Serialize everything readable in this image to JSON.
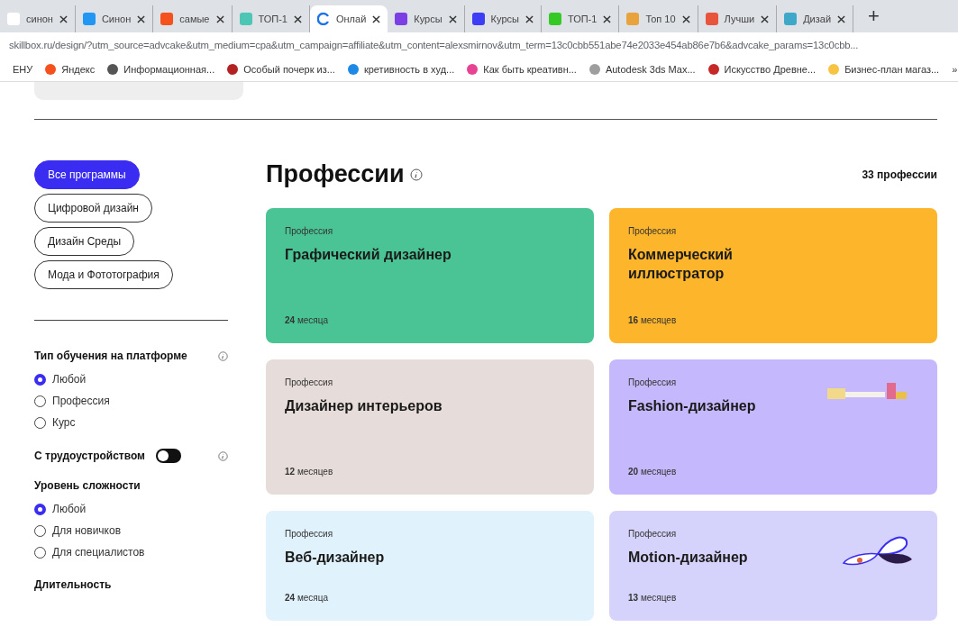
{
  "browser": {
    "tabs": [
      {
        "title": "синон",
        "selected": false,
        "color": "#ffffff"
      },
      {
        "title": "Синон",
        "selected": false,
        "color": "#2196f3"
      },
      {
        "title": "самые",
        "selected": false,
        "color": "#f4511e"
      },
      {
        "title": "ТОП-1",
        "selected": false,
        "color": "#4dc6b5"
      },
      {
        "title": "Онлай",
        "selected": true,
        "color": "#1a73e8"
      },
      {
        "title": "Курсы",
        "selected": false,
        "color": "#7b3fe4"
      },
      {
        "title": "Курсы",
        "selected": false,
        "color": "#3d3df5"
      },
      {
        "title": "ТОП-1",
        "selected": false,
        "color": "#34c924"
      },
      {
        "title": "Топ 10",
        "selected": false,
        "color": "#e8a33d"
      },
      {
        "title": "Лучши",
        "selected": false,
        "color": "#e8553d"
      },
      {
        "title": "Дизай",
        "selected": false,
        "color": "#3fa8c8"
      }
    ],
    "new_tab": "+",
    "url": "skillbox.ru/design/?utm_source=advcake&utm_medium=cpa&utm_campaign=affiliate&utm_content=alexsmirnov&utm_term=13c0cbb551abe74e2033e454ab86e7b6&advcake_params=13c0cbb...",
    "bookmarks": [
      {
        "label": "ЕНУ"
      },
      {
        "label": "Яндекс",
        "color": "#f4511e"
      },
      {
        "label": "Информационная...",
        "color": "#555555"
      },
      {
        "label": "Особый почерк из...",
        "color": "#b22222"
      },
      {
        "label": "кретивность в худ...",
        "color": "#1e88e5"
      },
      {
        "label": "Как быть креативн...",
        "color": "#e84393"
      },
      {
        "label": "Autodesk 3ds Max...",
        "color": "#9e9e9e"
      },
      {
        "label": "Искусство Древне...",
        "color": "#c62828"
      },
      {
        "label": "Бизнес-план магаз...",
        "color": "#f6c343"
      }
    ],
    "more_bookmarks": "»"
  },
  "categories": [
    {
      "label": "Все программы",
      "selected": true
    },
    {
      "label": "Цифровой дизайн",
      "selected": false
    },
    {
      "label": "Дизайн Среды",
      "selected": false
    },
    {
      "label": "Мода и Фототография",
      "selected": false
    }
  ],
  "filters": [
    {
      "kind": "radio",
      "title": "Тип обучения на платформе",
      "info": true,
      "options": [
        {
          "label": "Любой",
          "selected": true
        },
        {
          "label": "Профессия",
          "selected": false
        },
        {
          "label": "Курс",
          "selected": false
        }
      ]
    },
    {
      "kind": "toggle",
      "title": "С трудоустройством",
      "on": false,
      "info": true
    },
    {
      "kind": "radio",
      "title": "Уровень сложности",
      "info": false,
      "options": [
        {
          "label": "Любой",
          "selected": true
        },
        {
          "label": "Для новичков",
          "selected": false
        },
        {
          "label": "Для специалистов",
          "selected": false
        }
      ]
    },
    {
      "kind": "heading",
      "title": "Длительность",
      "info": false
    }
  ],
  "heading": {
    "title": "Профессии",
    "count": "33 профессии"
  },
  "cards": [
    {
      "kind": "plain",
      "label": "Профессия",
      "title": "Графический дизайнер",
      "duration": "**24** месяца",
      "color": "#4bc495"
    },
    {
      "kind": "plain",
      "label": "Профессия",
      "title": "Коммерческий иллюстратор",
      "duration": "**16** месяцев",
      "color": "#fdb52b"
    },
    {
      "kind": "plain",
      "label": "Профессия",
      "title": "Дизайнер интерьеров",
      "duration": "**12** месяцев",
      "color": "#e6dcd9"
    },
    {
      "kind": "bars",
      "label": "Профессия",
      "title": "Fashion-дизайнер",
      "duration": "**20** месяцев",
      "color": "#c6b8fc"
    },
    {
      "kind": "plain",
      "label": "Профессия",
      "title": "Веб-дизайнер",
      "duration": "**24** месяца",
      "color": "#e0f2fc"
    },
    {
      "kind": "butterfly",
      "label": "Профессия",
      "title": "Motion-дизайнер",
      "duration": "**13** месяцев",
      "color": "#d5d2fc"
    }
  ]
}
